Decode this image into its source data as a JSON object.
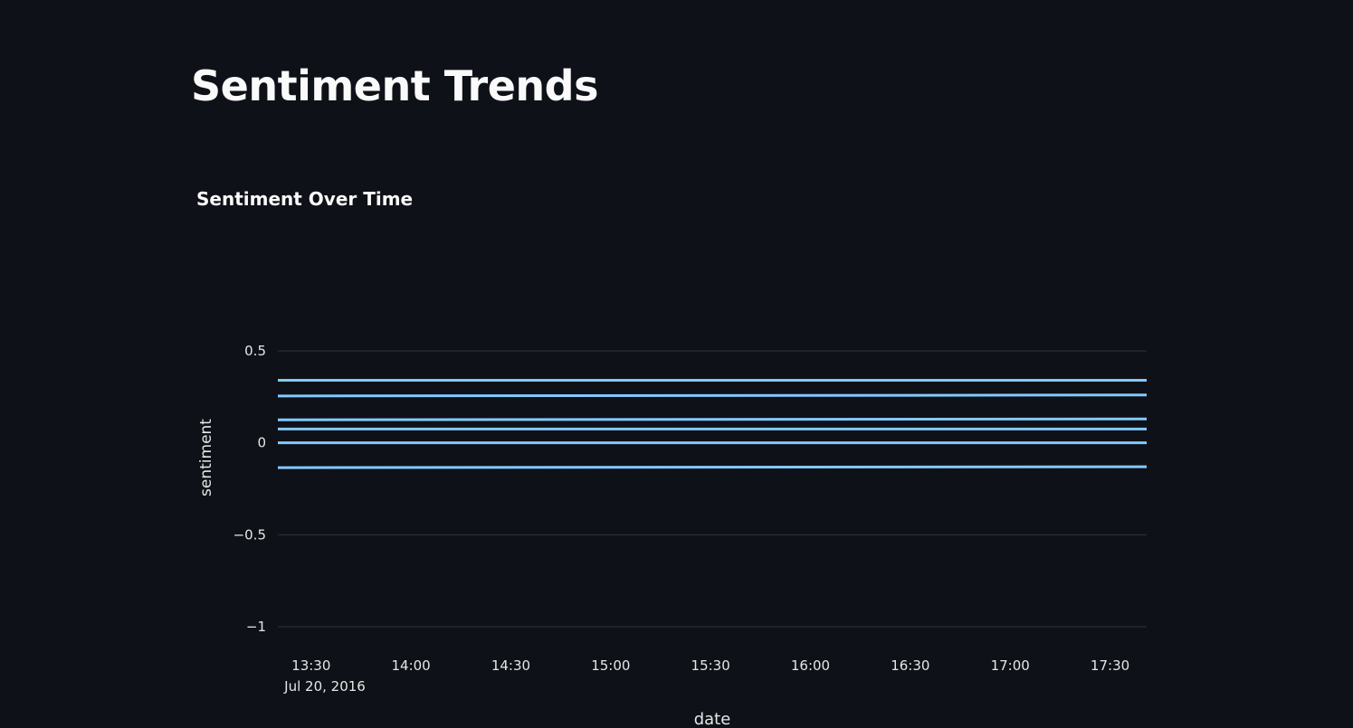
{
  "page": {
    "title": "Sentiment Trends"
  },
  "chart_data": {
    "type": "line",
    "title": "Sentiment Over Time",
    "xlabel": "date",
    "ylabel": "sentiment",
    "x_ticks": [
      "13:30",
      "14:00",
      "14:30",
      "15:00",
      "15:30",
      "16:00",
      "16:30",
      "17:00",
      "17:30"
    ],
    "x_date_label": "Jul 20, 2016",
    "xlim": [
      "2016-07-20 13:20",
      "2016-07-20 17:41"
    ],
    "y_ticks": [
      0.5,
      0,
      -0.5,
      -1
    ],
    "y_tick_labels": [
      "0.5",
      "0",
      "−0.5",
      "−1"
    ],
    "ylim": [
      -1,
      0.5
    ],
    "grid": true,
    "series_color": "#83c9ff",
    "series": [
      {
        "x": [
          "2016-07-20 13:20",
          "2016-07-20 17:41"
        ],
        "y": [
          0.34,
          0.34
        ]
      },
      {
        "x": [
          "2016-07-20 13:20",
          "2016-07-20 17:41"
        ],
        "y": [
          0.255,
          0.26
        ]
      },
      {
        "x": [
          "2016-07-20 13:20",
          "2016-07-20 17:41"
        ],
        "y": [
          0.125,
          0.13
        ]
      },
      {
        "x": [
          "2016-07-20 13:20",
          "2016-07-20 17:41"
        ],
        "y": [
          0.075,
          0.075
        ]
      },
      {
        "x": [
          "2016-07-20 13:20",
          "2016-07-20 17:41"
        ],
        "y": [
          0.0,
          0.0
        ]
      },
      {
        "x": [
          "2016-07-20 13:20",
          "2016-07-20 17:41"
        ],
        "y": [
          -0.135,
          -0.13
        ]
      }
    ]
  }
}
